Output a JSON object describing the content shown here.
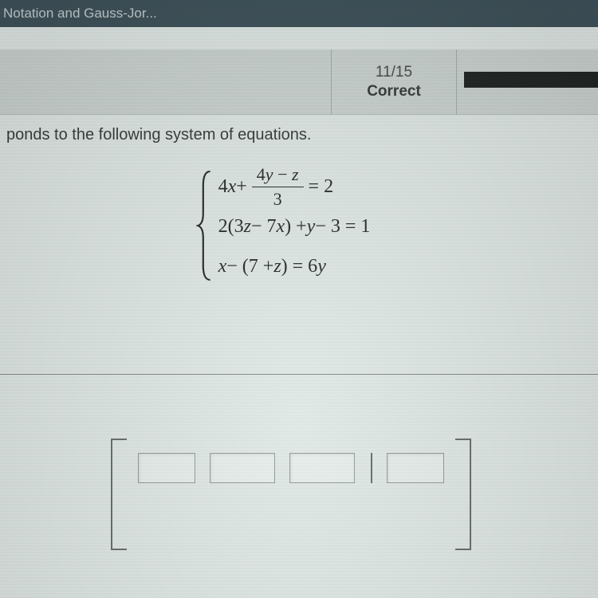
{
  "browser": {
    "tab_title": "Notation and Gauss-Jor..."
  },
  "progress": {
    "score": "11/15",
    "status": "Correct"
  },
  "question": {
    "prompt_fragment": "ponds to the following system of equations."
  },
  "equations": {
    "eq1_left": "4",
    "eq1_var1": "x",
    "eq1_plus": " + ",
    "eq1_frac_num_a": "4",
    "eq1_frac_num_var": "y",
    "eq1_frac_num_b": " − ",
    "eq1_frac_num_var2": "z",
    "eq1_frac_den": "3",
    "eq1_right": " = 2",
    "eq2_a": "2(3",
    "eq2_var1": "z",
    "eq2_b": " − 7",
    "eq2_var2": "x",
    "eq2_c": ") + ",
    "eq2_var3": "y",
    "eq2_d": " − 3 = 1",
    "eq3_var1": "x",
    "eq3_a": " − (7 + ",
    "eq3_var2": "z",
    "eq3_b": ") = 6",
    "eq3_var3": "y"
  }
}
